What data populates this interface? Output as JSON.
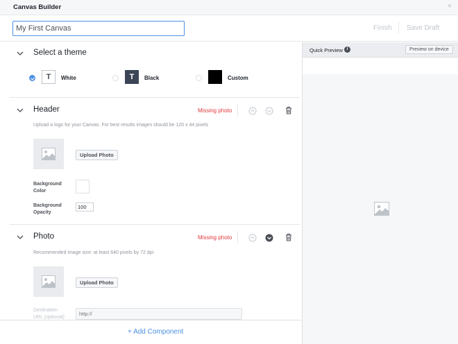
{
  "window": {
    "title": "Canvas Builder",
    "close_glyph": "×"
  },
  "toolbar": {
    "canvas_name": "My First Canvas",
    "finish_label": "Finish",
    "save_draft_label": "Save Draft"
  },
  "theme": {
    "title": "Select a theme",
    "options": [
      {
        "label": "White",
        "swatch_text": "T",
        "selected": true,
        "color": "#ffffff"
      },
      {
        "label": "Black",
        "swatch_text": "T",
        "selected": false,
        "color": "#3b4556"
      },
      {
        "label": "Custom",
        "swatch_text": "",
        "selected": false,
        "color": "#000000"
      }
    ]
  },
  "header_section": {
    "title": "Header",
    "status": "Missing photo",
    "description": "Upload a logo for your Canvas. For best results images should be 120 x 44 pixels",
    "upload_label": "Upload Photo",
    "bg_color_label": "Background Color",
    "bg_opacity_label": "Background Opacity",
    "bg_opacity_value": "100"
  },
  "photo_section": {
    "title": "Photo",
    "status": "Missing photo",
    "description": "Recommended image size: at least 640 pixels by 72 dpi",
    "upload_label": "Upload Photo",
    "destination_label": "Destination URL (optional)",
    "url_placeholder": "http://"
  },
  "add_component_label": "+ Add Component",
  "preview": {
    "title": "Quick Preview",
    "info_glyph": "i",
    "button_label": "Preview on device"
  },
  "colors": {
    "accent": "#4a90e2",
    "error": "#e0393e"
  }
}
